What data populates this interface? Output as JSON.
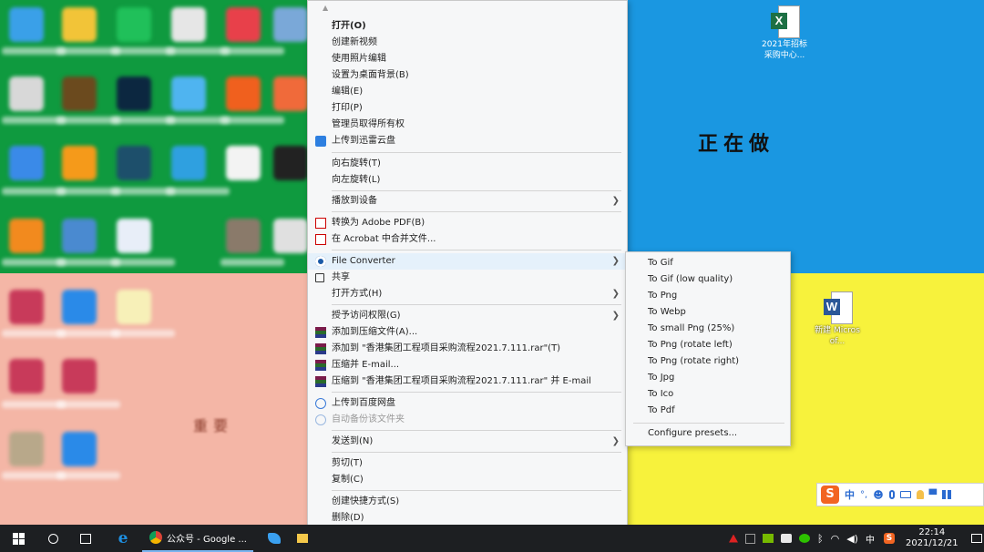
{
  "desktop": {
    "right_top_file": {
      "label": "2021年招标采购中心...",
      "icon": "excel-icon",
      "color": "#1d7044"
    },
    "right_mid_file": {
      "label": "新建 Microsof...",
      "icon": "word-icon",
      "color": "#2b5797"
    },
    "blurred_text_1": "正在做",
    "blurred_text_2": "重要",
    "colors": {
      "green": "#0f9a3f",
      "blue": "#1a97e1",
      "yellow": "#f7f23c",
      "pink": "#f4b6a6"
    }
  },
  "context_menu": {
    "items": [
      {
        "label": "打开(O)",
        "bold": true
      },
      {
        "label": "创建新视频"
      },
      {
        "label": "使用照片编辑"
      },
      {
        "label": "设置为桌面背景(B)"
      },
      {
        "label": "编辑(E)"
      },
      {
        "label": "打印(P)"
      },
      {
        "label": "管理员取得所有权"
      },
      {
        "label": "上传到迅雷云盘",
        "icon": "thunder-cloud-icon"
      },
      {
        "label": "向右旋转(T)"
      },
      {
        "label": "向左旋转(L)"
      },
      {
        "label": "播放到设备",
        "submenu": true
      },
      {
        "label": "转换为 Adobe PDF(B)",
        "icon": "adobe-pdf-icon"
      },
      {
        "label": "在 Acrobat 中合并文件...",
        "icon": "acrobat-icon"
      },
      {
        "label": "File Converter",
        "icon": "file-converter-icon",
        "submenu": true,
        "highlighted": true
      },
      {
        "label": "共享",
        "icon": "share-icon"
      },
      {
        "label": "打开方式(H)",
        "submenu": true
      },
      {
        "label": "授予访问权限(G)",
        "submenu": true
      },
      {
        "label": "添加到压缩文件(A)...",
        "icon": "winrar-icon"
      },
      {
        "label": "添加到 \"香港集团工程项目采购流程2021.7.111.rar\"(T)",
        "icon": "winrar-icon"
      },
      {
        "label": "压缩并 E-mail...",
        "icon": "winrar-icon"
      },
      {
        "label": "压缩到 \"香港集团工程项目采购流程2021.7.111.rar\" 并 E-mail",
        "icon": "winrar-icon"
      },
      {
        "label": "上传到百度网盘",
        "icon": "baidu-cloud-icon"
      },
      {
        "label": "自动备份该文件夹",
        "icon": "baidu-cloud-icon",
        "disabled": true
      },
      {
        "label": "发送到(N)",
        "submenu": true
      },
      {
        "label": "剪切(T)"
      },
      {
        "label": "复制(C)"
      },
      {
        "label": "创建快捷方式(S)"
      },
      {
        "label": "删除(D)"
      }
    ]
  },
  "submenu": {
    "items": [
      "To Gif",
      "To Gif (low quality)",
      "To Png",
      "To Webp",
      "To small Png (25%)",
      "To Png (rotate left)",
      "To Png (rotate right)",
      "To Jpg",
      "To Ico",
      "To Pdf"
    ],
    "configure": "Configure presets..."
  },
  "ime_bar": {
    "items": [
      "中",
      "°,"
    ]
  },
  "taskbar": {
    "browser_tab": "公众号 - Google ...",
    "tray_lang": "中",
    "time": "22:14",
    "date": "2021/12/21"
  }
}
